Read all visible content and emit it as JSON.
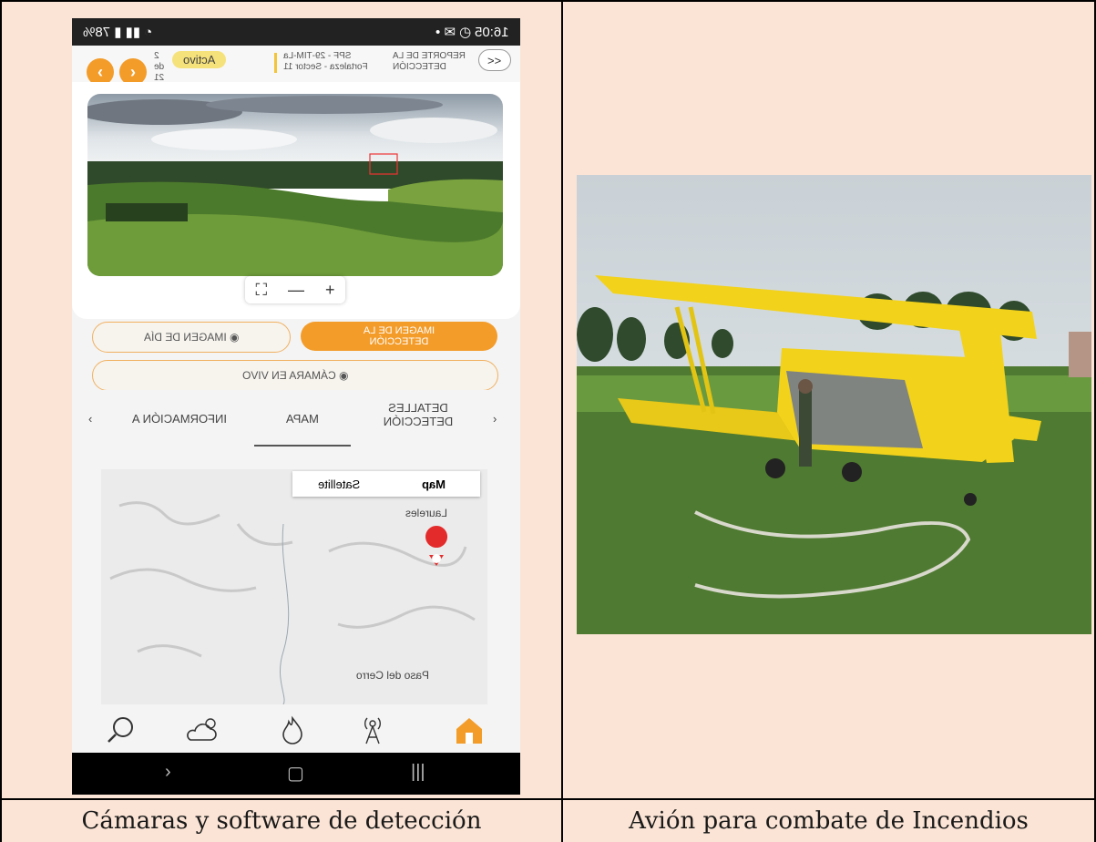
{
  "captions": {
    "left": "Cámaras y software de detección",
    "right": "Avión para combate de Incendios"
  },
  "phone": {
    "status_time": "16:05",
    "status_battery": "78%",
    "header": {
      "active_label": "Activo",
      "counter_a": "2",
      "counter_de": "de",
      "counter_b": "21",
      "camera_line1": "SPF - 29-TIM-La",
      "camera_line2": "Fortaleza - Sector 11",
      "report_line1": "REPORTE DE LA",
      "report_line2": "DETECCIÓN",
      "collapse_label": "<<"
    },
    "zoom": {
      "fit": "⛶",
      "minus": "—",
      "plus": "+"
    },
    "buttons": {
      "detection_image": "IMAGEN DE LA DETECCIÓN",
      "day_image": "IMAGEN DE DÍA",
      "live_camera": "CÁMARA EN VIVO"
    },
    "tabs": {
      "details": "DETALLES DETECCIÓN",
      "map": "MAPA",
      "info": "INFORMACIÓN A"
    },
    "map": {
      "btn_map": "Map",
      "btn_satellite": "Satellite",
      "place_1": "Laureles",
      "place_2": "Paso del Cerro"
    }
  },
  "colors": {
    "page_bg": "#fbe4d5",
    "accent": "#f39c2a",
    "plane_yellow": "#f2d21b"
  }
}
